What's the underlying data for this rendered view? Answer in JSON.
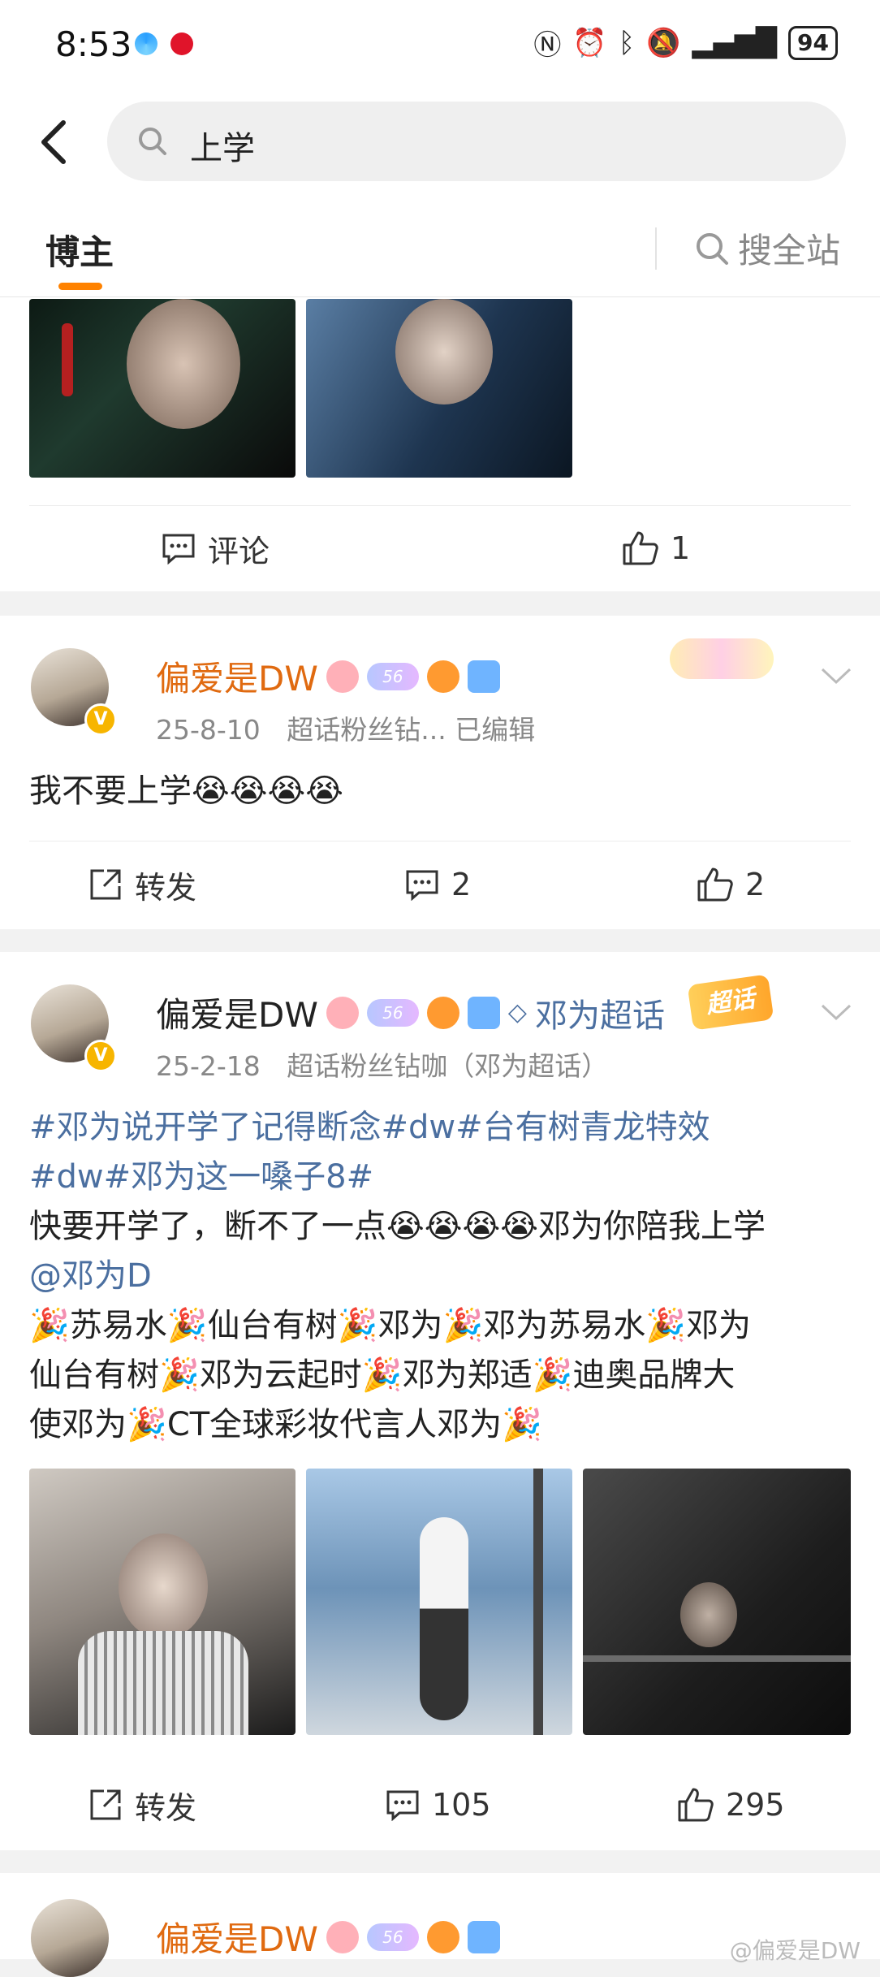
{
  "status_bar": {
    "time": "8:53",
    "battery": "94"
  },
  "search": {
    "query": "上学"
  },
  "tabs": {
    "active": "博主",
    "search_all": "搜全站"
  },
  "post1_actions": {
    "comment_label": "评论",
    "like_count": "1"
  },
  "post2": {
    "username": "偏爱是DW",
    "level": "56",
    "date": "25-8-10",
    "meta": "超话粉丝钻... 已编辑",
    "text": "我不要上学",
    "repost_label": "转发",
    "comment_count": "2",
    "like_count": "2"
  },
  "post3": {
    "username": "偏爱是DW",
    "level": "56",
    "topic_tag": "邓为超话",
    "badge": "超话",
    "date": "25-2-18",
    "meta": "超话粉丝钻咖（邓为超话）",
    "line1": "#邓为说开学了记得断念#dw#台有树青龙特效",
    "line2": "#dw#邓为这一嗓子8#",
    "line3a": "快要开学了，断不了一点",
    "line3b": "邓为你陪我上学",
    "mention": "@邓为D",
    "tags": [
      "苏易水",
      "仙台有树",
      "邓为",
      "邓为苏易水",
      "邓为",
      "仙台有树",
      "邓为云起时",
      "邓为郑适",
      "迪奥品牌大",
      "使邓为",
      "CT全球彩妆代言人邓为"
    ],
    "repost_label": "转发",
    "comment_count": "105",
    "like_count": "295"
  },
  "post4": {
    "username": "偏爱是DW",
    "level": "56"
  },
  "watermark": "@偏爱是DW",
  "colors": {
    "accent": "#ff8200",
    "username_vip": "#e06a10",
    "topic": "#4b6fa0"
  }
}
